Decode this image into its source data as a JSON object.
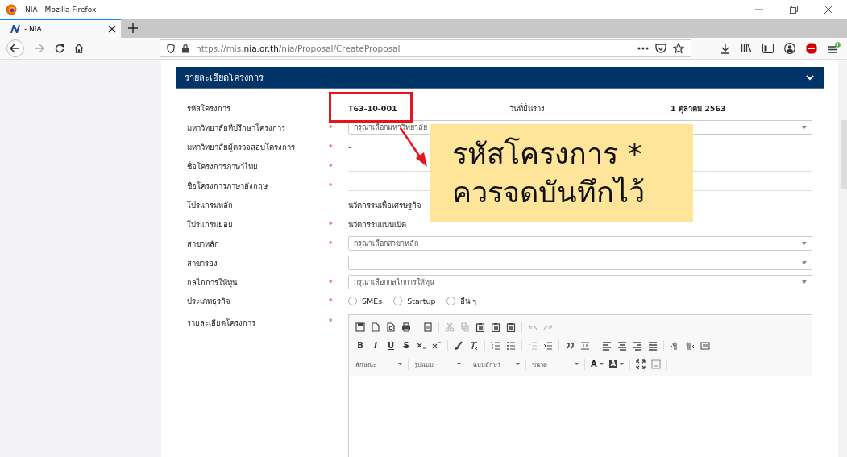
{
  "window": {
    "title": "- NIA - Mozilla Firefox"
  },
  "tabs": [
    {
      "label": "- NIA",
      "selected": true
    }
  ],
  "address_bar": {
    "url": "https://mis.**nia.or.th**/nia/Proposal/CreateProposal"
  },
  "panel": {
    "title": "รายละเอียดโครงการ",
    "fields": [
      {
        "kind": "text",
        "label": "รหัสโครงการ",
        "value": "T63-10-001",
        "extra_label": "วันที่ยื่นร่าง",
        "extra_value": "1 ตุลาคม 2563"
      },
      {
        "kind": "select",
        "label": "มหาวิทยาลัยที่ปรึกษาโครงการ",
        "required_mark": "*",
        "placeholder": "กรุณาเลือกมหาวิทยาลัย"
      },
      {
        "kind": "text",
        "label": "มหาวิทยาลัยผู้ตรวจสอบโครงการ",
        "required_mark": "*",
        "value": "-"
      },
      {
        "kind": "line",
        "label": "ชื่อโครงการภาษาไทย",
        "required_mark": "*"
      },
      {
        "kind": "line",
        "label": "ชื่อโครงการภาษาอังกฤษ",
        "required_mark": "*"
      },
      {
        "kind": "text",
        "label": "โปรแกรมหลัก",
        "value": "นวัตกรรมเพื่อเศรษฐกิจ"
      },
      {
        "kind": "text",
        "label": "โปรแกรมย่อย",
        "required_mark": "*",
        "value": "นวัตกรรมแบบเปิด"
      },
      {
        "kind": "select",
        "label": "สาขาหลัก",
        "required_mark": "*",
        "placeholder": "กรุณาเลือกสาขาหลัก"
      },
      {
        "kind": "select",
        "label": "สาขารอง"
      },
      {
        "kind": "select",
        "label": "กลไกการให้ทุน",
        "required_mark": "*",
        "placeholder": "กรุณาเลือกกลไกการให้ทุน"
      },
      {
        "kind": "radio",
        "label": "ประเภทธุรกิจ",
        "required_mark": "*",
        "options": [
          {
            "label": "SMEs",
            "selected": false
          },
          {
            "label": "Startup",
            "selected": false
          },
          {
            "label": "อื่น ๆ",
            "selected": false
          }
        ]
      },
      {
        "kind": "editor",
        "label": "รายละเอียดโครงการ",
        "required_mark": "*",
        "format_buttons": [
          "B",
          "I",
          "U",
          "S"
        ],
        "dropdowns": [
          "ลักษณะ",
          "รูปแบบ",
          "แบบอักษร",
          "ขนาด"
        ],
        "color_buttons": [
          "A",
          "A"
        ]
      }
    ]
  },
  "callout": {
    "lines": [
      "รหัสโครงการ *",
      "ควรจดบันทึกไว้"
    ]
  }
}
